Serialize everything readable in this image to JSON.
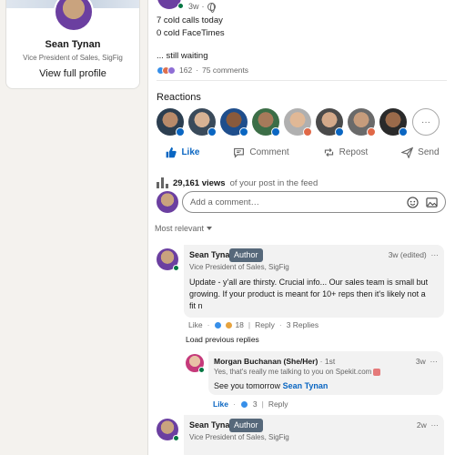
{
  "profile": {
    "name": "Sean Tynan",
    "title": "Vice President of Sales, SigFig",
    "view_link": "View full profile"
  },
  "post": {
    "header_partial": "Vice President of Sales, SigFig",
    "age": "3w",
    "lines": [
      "7 cold calls today",
      "0 cold FaceTimes",
      "... still waiting"
    ],
    "reaction_count": "162",
    "separator": "·",
    "comments_count": "75 comments"
  },
  "reactions": {
    "title": "Reactions",
    "more_label": "···",
    "reactors": [
      {
        "skin": "#b88a6a",
        "bg": "#2c3e50",
        "badge": "#0a66c2"
      },
      {
        "skin": "#d7b294",
        "bg": "#3a4a5a",
        "badge": "#0a66c2"
      },
      {
        "skin": "#8a5a3c",
        "bg": "#1f4e8c",
        "badge": "#0a66c2"
      },
      {
        "skin": "#a77a5a",
        "bg": "#3c6e47",
        "badge": "#0a66c2"
      },
      {
        "skin": "#e0b896",
        "bg": "#b0b0b0",
        "badge": "#e06847"
      },
      {
        "skin": "#d3a98a",
        "bg": "#4a4a4a",
        "badge": "#0a66c2"
      },
      {
        "skin": "#c69c7c",
        "bg": "#6a6a6a",
        "badge": "#e06847"
      },
      {
        "skin": "#9a6a4a",
        "bg": "#2a2a2a",
        "badge": "#0a66c2"
      }
    ]
  },
  "actions": {
    "like": "Like",
    "comment": "Comment",
    "repost": "Repost",
    "send": "Send"
  },
  "views": {
    "count": "29,161 views",
    "suffix": "of your post in the feed"
  },
  "comment_input": {
    "placeholder": "Add a comment…"
  },
  "sort": {
    "label": "Most relevant"
  },
  "comments": [
    {
      "name": "Sean Tynan",
      "badge": "Author",
      "subtitle": "Vice President of Sales, SigFig",
      "time": "3w (edited)",
      "more": "···",
      "body_lines": [
        "Update - y'all are thirsty. Crucial info... Our sales team is small but",
        "growing. If your product is meant for 10+ reps then it's likely not a",
        "fit n"
      ],
      "like_label": "Like",
      "reaction_count": "18",
      "reply_label": "Reply",
      "replies_count": "3 Replies"
    }
  ],
  "load_previous": "Load previous replies",
  "reply": {
    "name": "Morgan Buchanan (She/Her)",
    "degree": "· 1st",
    "subtitle": "Yes, that's really me talking to you on Spekit.com",
    "time": "3w",
    "more": "···",
    "body_prefix": "See you tomorrow",
    "mention": "Sean Tynan",
    "like_label": "Like",
    "reaction_count": "3",
    "reply_label": "Reply"
  },
  "comment2": {
    "name": "Sean Tynan",
    "badge": "Author",
    "subtitle": "Vice President of Sales, SigFig",
    "time": "2w",
    "more": "···"
  },
  "colors": {
    "accent": "#0a66c2",
    "author_badge": "#56687a",
    "online": "#057642",
    "comment_bg": "#f2f2f2"
  }
}
